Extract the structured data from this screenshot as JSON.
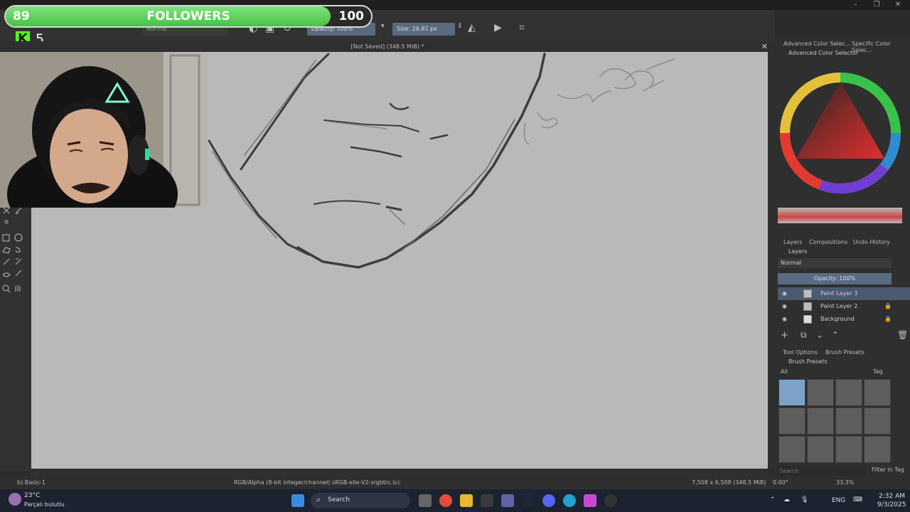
{
  "window": {
    "min": "–",
    "max": "❐",
    "close": "✕"
  },
  "overlay": {
    "followers_current": "89",
    "followers_label": "FOLLOWERS",
    "followers_goal": "100",
    "followers_progress": 0.89,
    "kick_logo": "K",
    "kick_count": "5"
  },
  "toolbar": {
    "blend_mode": "Normal",
    "opacity": "Opacity: 100%",
    "size": "Size: 26.81 px"
  },
  "canvas": {
    "title": "[Not Saved]  (348.5 MiB) *",
    "close": "✕"
  },
  "dock": {
    "tabs_top": [
      "Advanced Color Selec...",
      "Specific Color Selec..."
    ],
    "color_panel_title": "Advanced Color Selector",
    "tabs_mid": [
      "Layers",
      "Compositions",
      "Undo History"
    ],
    "layers_title": "Layers",
    "layers_blend": "Normal",
    "layers_opacity": "Opacity:  100%",
    "layers": [
      {
        "name": "Paint Layer 3",
        "selected": true
      },
      {
        "name": "Paint Layer 2",
        "selected": false
      },
      {
        "name": "Background",
        "selected": false
      }
    ],
    "tabs_bottom": [
      "Tool Options",
      "Brush Presets"
    ],
    "brush_title": "Brush Presets",
    "brush_filter": "All",
    "brush_tag": "Tag",
    "search_placeholder": "Search",
    "filter_in_tag": "Filter in Tag"
  },
  "status": {
    "brush": "b) Basic-1",
    "color_space": "RGB/Alpha (8-bit integer/channel)  sRGB-elle-V2-srgbtrc.icc",
    "dimensions": "7,508 x 6,508 (348.5 MiB)",
    "rotation": "0.00°",
    "zoom": "33.3%"
  },
  "taskbar": {
    "weather_temp": "23°C",
    "weather_desc": "Parçalı bulutlu",
    "search_label": "Search",
    "lang": "ENG",
    "time": "2:32 AM",
    "date": "9/3/2025"
  },
  "colors": {
    "accent": "#5a6b80",
    "canvas": "#b9b9b9",
    "followers_fill": "#48c245",
    "kick": "#53fc18"
  }
}
